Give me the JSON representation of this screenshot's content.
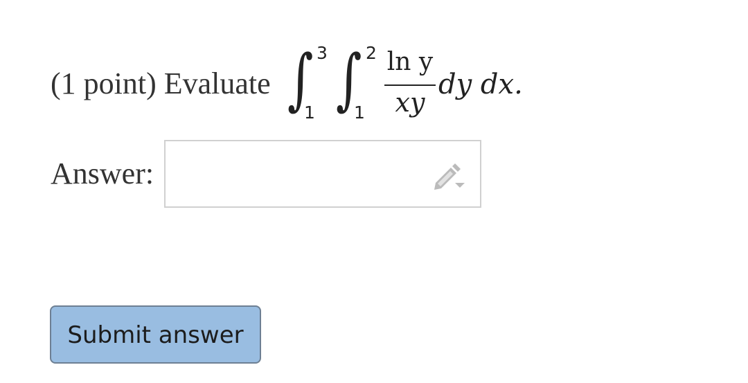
{
  "problem": {
    "prompt": "(1 point) Evaluate",
    "math": {
      "outer_upper": "3",
      "outer_lower": "1",
      "inner_upper": "2",
      "inner_lower": "1",
      "numerator": "ln y",
      "denominator": "xy",
      "differentials": "dy dx."
    }
  },
  "answer": {
    "label": "Answer:",
    "value": "",
    "placeholder": "",
    "icon": "pencil-icon"
  },
  "actions": {
    "submit_label": "Submit answer"
  },
  "colors": {
    "text": "#333333",
    "input_border": "#d0d0d0",
    "button_bg": "#99bde1",
    "button_border": "#6d7f93",
    "icon": "#bbbbbb"
  }
}
